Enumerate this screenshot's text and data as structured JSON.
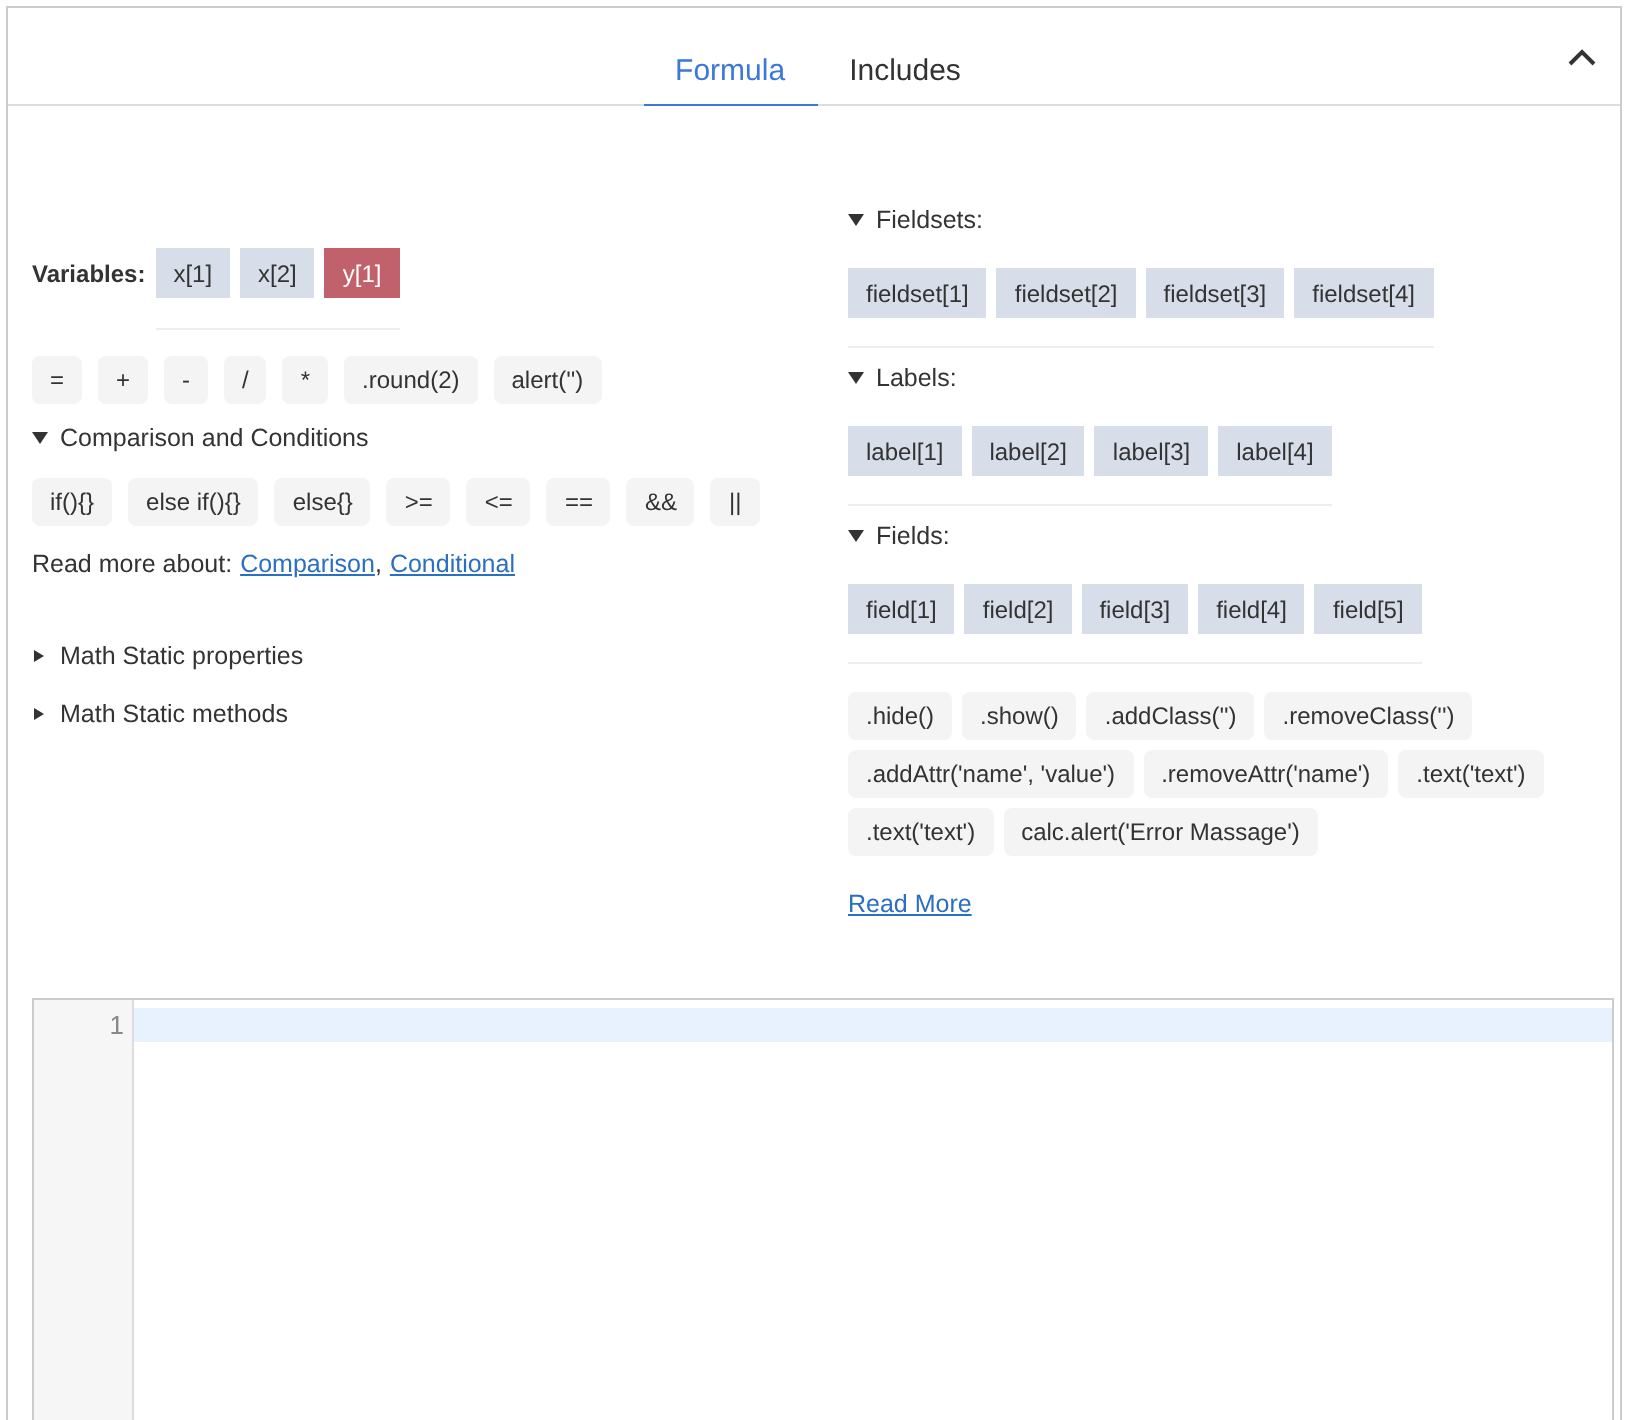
{
  "tabs": [
    {
      "label": "Formula",
      "selected": true
    },
    {
      "label": "Includes",
      "selected": false
    }
  ],
  "collapse_button": {
    "expanded": true
  },
  "variables": {
    "label": "Variables:",
    "items": [
      {
        "label": "x[1]",
        "selected": false
      },
      {
        "label": "x[2]",
        "selected": false
      },
      {
        "label": "y[1]",
        "selected": true
      }
    ]
  },
  "operators": [
    "=",
    "+",
    "-",
    "/",
    "*",
    ".round(2)",
    "alert('')"
  ],
  "comparison": {
    "title": "Comparison and Conditions",
    "expanded": true,
    "items": [
      "if(){}",
      "else if(){}",
      "else{}",
      ">=",
      "<=",
      "==",
      "&&",
      "||"
    ]
  },
  "read_more_about": {
    "label": "Read more about:",
    "links": [
      "Comparison ",
      "Conditional"
    ],
    "separator": ","
  },
  "math_sections": [
    {
      "title": "Math Static properties",
      "expanded": false
    },
    {
      "title": "Math Static methods",
      "expanded": false
    }
  ],
  "groups": [
    {
      "title": "Fieldsets:",
      "expanded": true,
      "items": [
        "fieldset[1]",
        "fieldset[2]",
        "fieldset[3]",
        "fieldset[4]"
      ]
    },
    {
      "title": "Labels:",
      "expanded": true,
      "items": [
        "label[1]",
        "label[2]",
        "label[3]",
        "label[4]"
      ]
    },
    {
      "title": "Fields:",
      "expanded": true,
      "items": [
        "field[1]",
        "field[2]",
        "field[3]",
        "field[4]",
        "field[5]"
      ]
    }
  ],
  "methods": [
    ".hide()",
    ".show()",
    ".addClass('')",
    ".removeClass('')",
    ".addAttr('name', 'value')",
    ".removeAttr('name')",
    ".text('text')",
    ".text('text')",
    "calc.alert('Error Massage')"
  ],
  "read_more": "Read More",
  "editor": {
    "line_numbers": [
      "1"
    ]
  }
}
